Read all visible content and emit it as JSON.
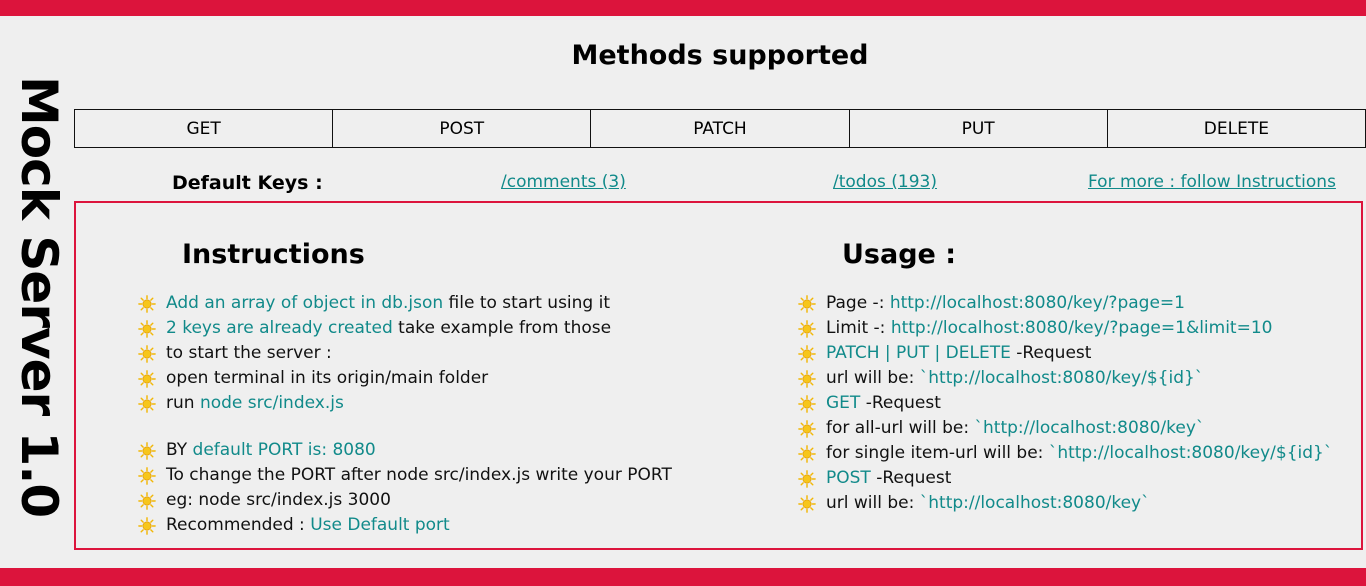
{
  "side_title": "Mock Server 1.0",
  "methods_title": "Methods supported",
  "methods": [
    "GET",
    "POST",
    "PATCH",
    "PUT",
    "DELETE"
  ],
  "default_keys": {
    "label": "Default Keys :",
    "comments_link": "/comments (3)",
    "todos_link": "/todos (193)",
    "more_link": "For more : follow Instructions"
  },
  "instructions": {
    "heading": "Instructions",
    "items": [
      {
        "link": "Add an array of object in db.json",
        "text": " file to start using it"
      },
      {
        "link": "2 keys are already created",
        "text": " take example from those"
      },
      {
        "text": "to start the server :"
      },
      {
        "text": "open terminal in its origin/main folder"
      },
      {
        "text": "run ",
        "link": "node src/index.js"
      },
      {
        "text": "BY ",
        "link": "default PORT is: 8080"
      },
      {
        "text": "To change the PORT after node src/index.js write your PORT"
      },
      {
        "text": "eg: node src/index.js 3000"
      },
      {
        "text": "Recommended : ",
        "link": "Use Default port"
      }
    ]
  },
  "usage": {
    "heading": "Usage :",
    "items": [
      {
        "text": "Page -: ",
        "link": "http://localhost:8080/key/?page=1"
      },
      {
        "text": "Limit -: ",
        "link": "http://localhost:8080/key/?page=1&limit=10"
      },
      {
        "link": "PATCH | PUT | DELETE",
        "text": " -Request"
      },
      {
        "text": "url will be: ",
        "link": "`http://localhost:8080/key/${id}`"
      },
      {
        "link": "GET",
        "text": " -Request"
      },
      {
        "text": "for all-url will be: ",
        "link": "`http://localhost:8080/key`"
      },
      {
        "text": "for single item-url will be: ",
        "link": "`http://localhost:8080/key/${id}`"
      },
      {
        "link": "POST",
        "text": " -Request"
      },
      {
        "text": "url will be: ",
        "link": "`http://localhost:8080/key`"
      }
    ]
  },
  "colors": {
    "accent": "#dc143c",
    "link": "#118a8a",
    "background": "#efefef"
  },
  "icons": {
    "bullet": "sun-icon"
  }
}
